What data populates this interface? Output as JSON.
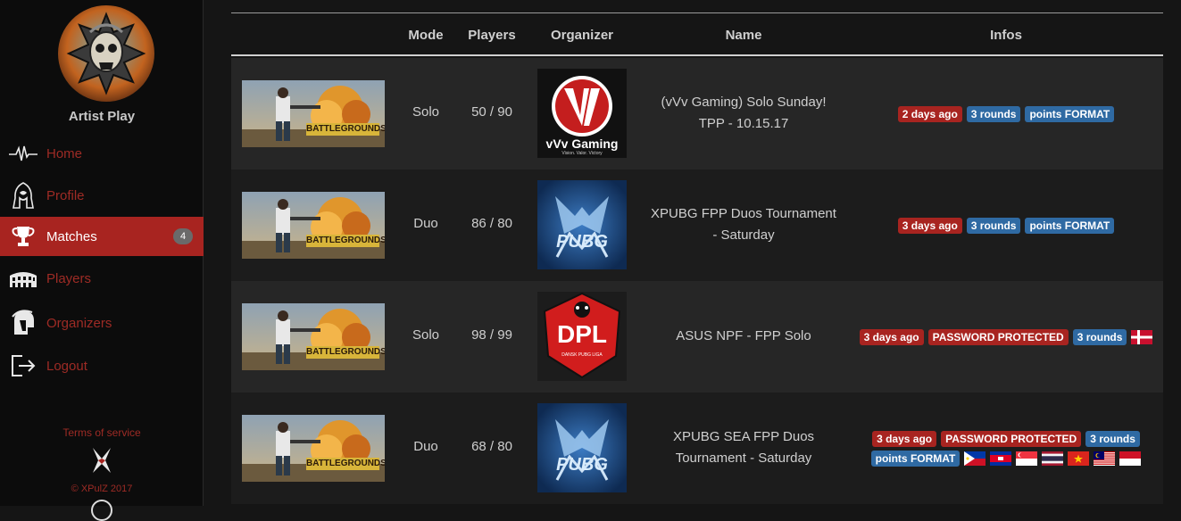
{
  "sidebar": {
    "username": "Artist Play",
    "nav": [
      {
        "label": "Home",
        "icon": "heartbeat-icon"
      },
      {
        "label": "Profile",
        "icon": "hooded-figure-icon"
      },
      {
        "label": "Matches",
        "icon": "trophy-icon",
        "badge": "4"
      },
      {
        "label": "Players",
        "icon": "colosseum-icon"
      },
      {
        "label": "Organizers",
        "icon": "spartan-helmet-icon"
      },
      {
        "label": "Logout",
        "icon": "logout-icon"
      }
    ],
    "terms": "Terms of service",
    "copyright": "© XPulZ 2017"
  },
  "table": {
    "headers": {
      "mode": "Mode",
      "players": "Players",
      "organizer": "Organizer",
      "name": "Name",
      "infos": "Infos"
    },
    "rows": [
      {
        "game_banner": "BATTLEGROUNDS",
        "mode": "Solo",
        "players": "50 / 90",
        "organizer_logo": "vVv Gaming",
        "organizer_tagline": "Vision. Valor. Victory",
        "name_line1": "(vVv Gaming) Solo Sunday!",
        "name_line2": "TPP - 10.15.17",
        "tags": [
          {
            "text": "2 days ago",
            "color": "red"
          },
          {
            "text": "3 rounds",
            "color": "blue"
          },
          {
            "text": "points FORMAT",
            "color": "blue"
          }
        ],
        "flags": []
      },
      {
        "game_banner": "BATTLEGROUNDS",
        "mode": "Duo",
        "players": "86 / 80",
        "organizer_logo": "PUBG",
        "name_line1": "XPUBG FPP Duos Tournament",
        "name_line2": "- Saturday",
        "tags": [
          {
            "text": "3 days ago",
            "color": "red"
          },
          {
            "text": "3 rounds",
            "color": "blue"
          },
          {
            "text": "points FORMAT",
            "color": "blue"
          }
        ],
        "flags": []
      },
      {
        "game_banner": "BATTLEGROUNDS",
        "mode": "Solo",
        "players": "98 / 99",
        "organizer_logo": "DPL",
        "organizer_tagline": "DANSK PUBG LIGA",
        "name_line1": "ASUS NPF - FPP Solo",
        "name_line2": "",
        "tags": [
          {
            "text": "3 days ago",
            "color": "red"
          },
          {
            "text": "PASSWORD PROTECTED",
            "color": "red"
          },
          {
            "text": "3 rounds",
            "color": "blue"
          }
        ],
        "flags": [
          "denmark"
        ]
      },
      {
        "game_banner": "BATTLEGROUNDS",
        "mode": "Duo",
        "players": "68 / 80",
        "organizer_logo": "PUBG",
        "name_line1": "XPUBG SEA FPP Duos",
        "name_line2": "Tournament - Saturday",
        "tags": [
          {
            "text": "3 days ago",
            "color": "red"
          },
          {
            "text": "PASSWORD PROTECTED",
            "color": "red"
          },
          {
            "text": "3 rounds",
            "color": "blue"
          },
          {
            "text": "points FORMAT",
            "color": "blue"
          }
        ],
        "flags": [
          "philippines",
          "cambodia",
          "singapore",
          "thailand",
          "vietnam",
          "malaysia",
          "indonesia"
        ]
      }
    ]
  },
  "colors": {
    "accent": "#a82420",
    "tag_blue": "#2f6aa3",
    "link_red": "#9e2b25"
  }
}
